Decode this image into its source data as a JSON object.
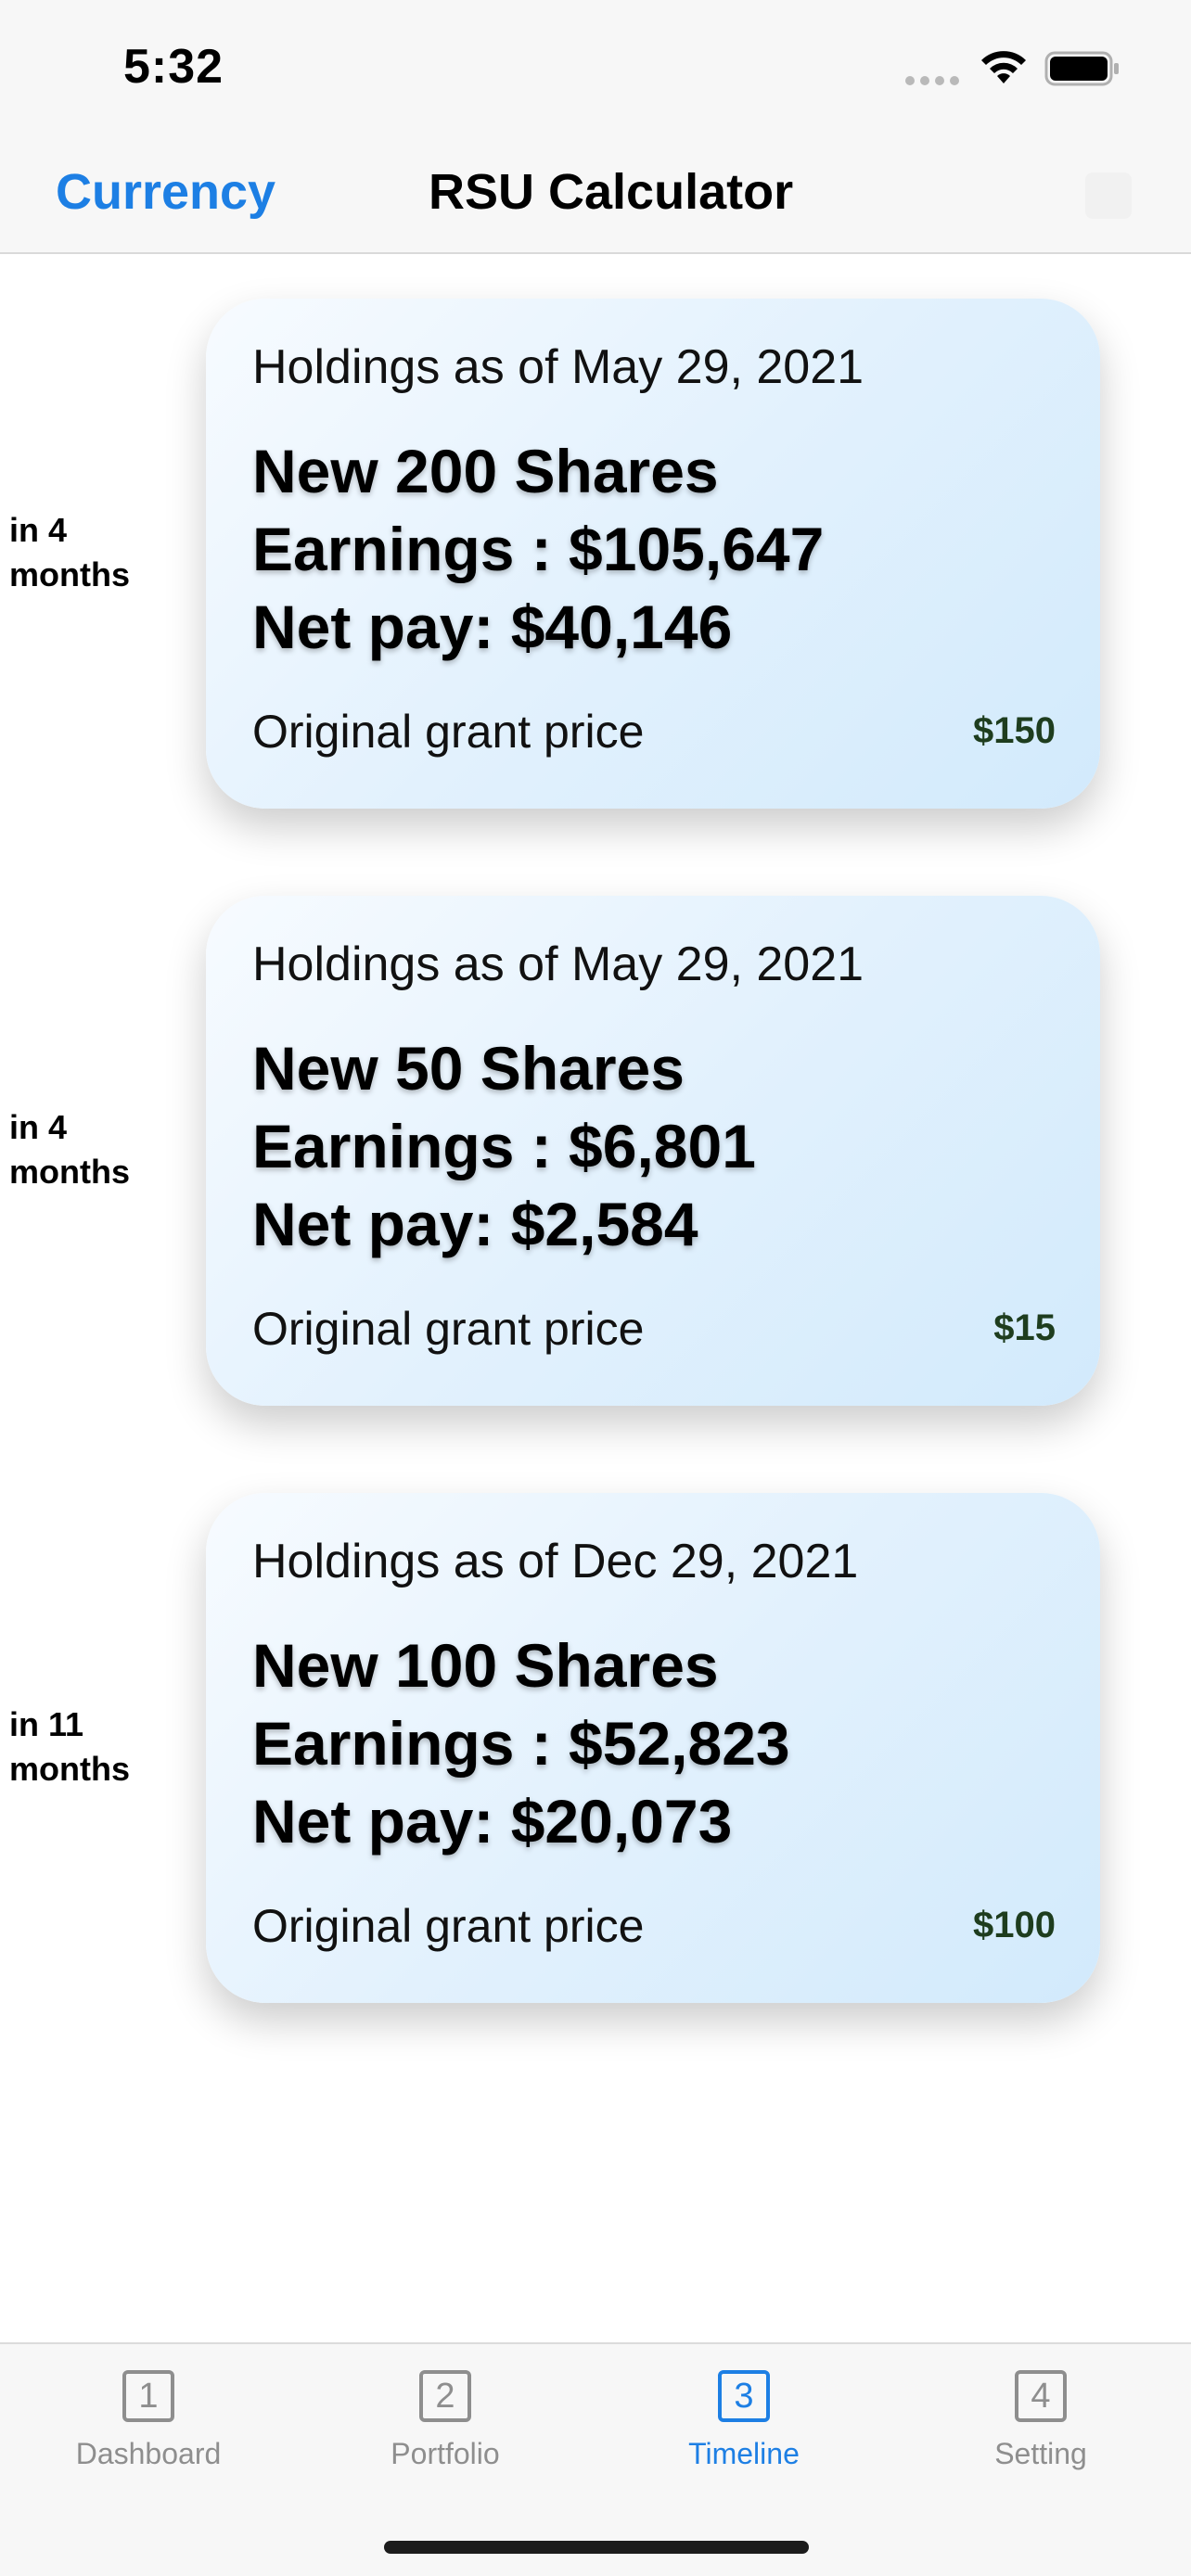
{
  "status_bar": {
    "time": "5:32",
    "icons": [
      "signal-icon",
      "wifi-icon",
      "battery-icon"
    ]
  },
  "nav": {
    "left_label": "Currency",
    "title": "RSU Calculator",
    "right_icon": "plus-icon"
  },
  "entries": [
    {
      "when": "in 4 months",
      "date": "Holdings as of May 29, 2021",
      "shares": "New 200 Shares",
      "earnings": "Earnings : $105,647",
      "net_pay": "Net pay: $40,146",
      "grant_label": "Original grant price",
      "grant_price": "$150"
    },
    {
      "when": "in 4 months",
      "date": "Holdings as of May 29, 2021",
      "shares": "New 50 Shares",
      "earnings": "Earnings : $6,801",
      "net_pay": "Net pay: $2,584",
      "grant_label": "Original grant price",
      "grant_price": "$15"
    },
    {
      "when": "in 11 months",
      "date": "Holdings as of Dec 29, 2021",
      "shares": "New 100 Shares",
      "earnings": "Earnings : $52,823",
      "net_pay": "Net pay: $20,073",
      "grant_label": "Original grant price",
      "grant_price": "$100"
    }
  ],
  "tabs": [
    {
      "icon_text": "1",
      "label": "Dashboard",
      "active": false
    },
    {
      "icon_text": "2",
      "label": "Portfolio",
      "active": false
    },
    {
      "icon_text": "3",
      "label": "Timeline",
      "active": true
    },
    {
      "icon_text": "4",
      "label": "Setting",
      "active": false
    }
  ],
  "colors": {
    "accent": "#1d7fe4",
    "grant_price": "#1e3d1e",
    "inactive_tab": "#8e8e8e"
  }
}
